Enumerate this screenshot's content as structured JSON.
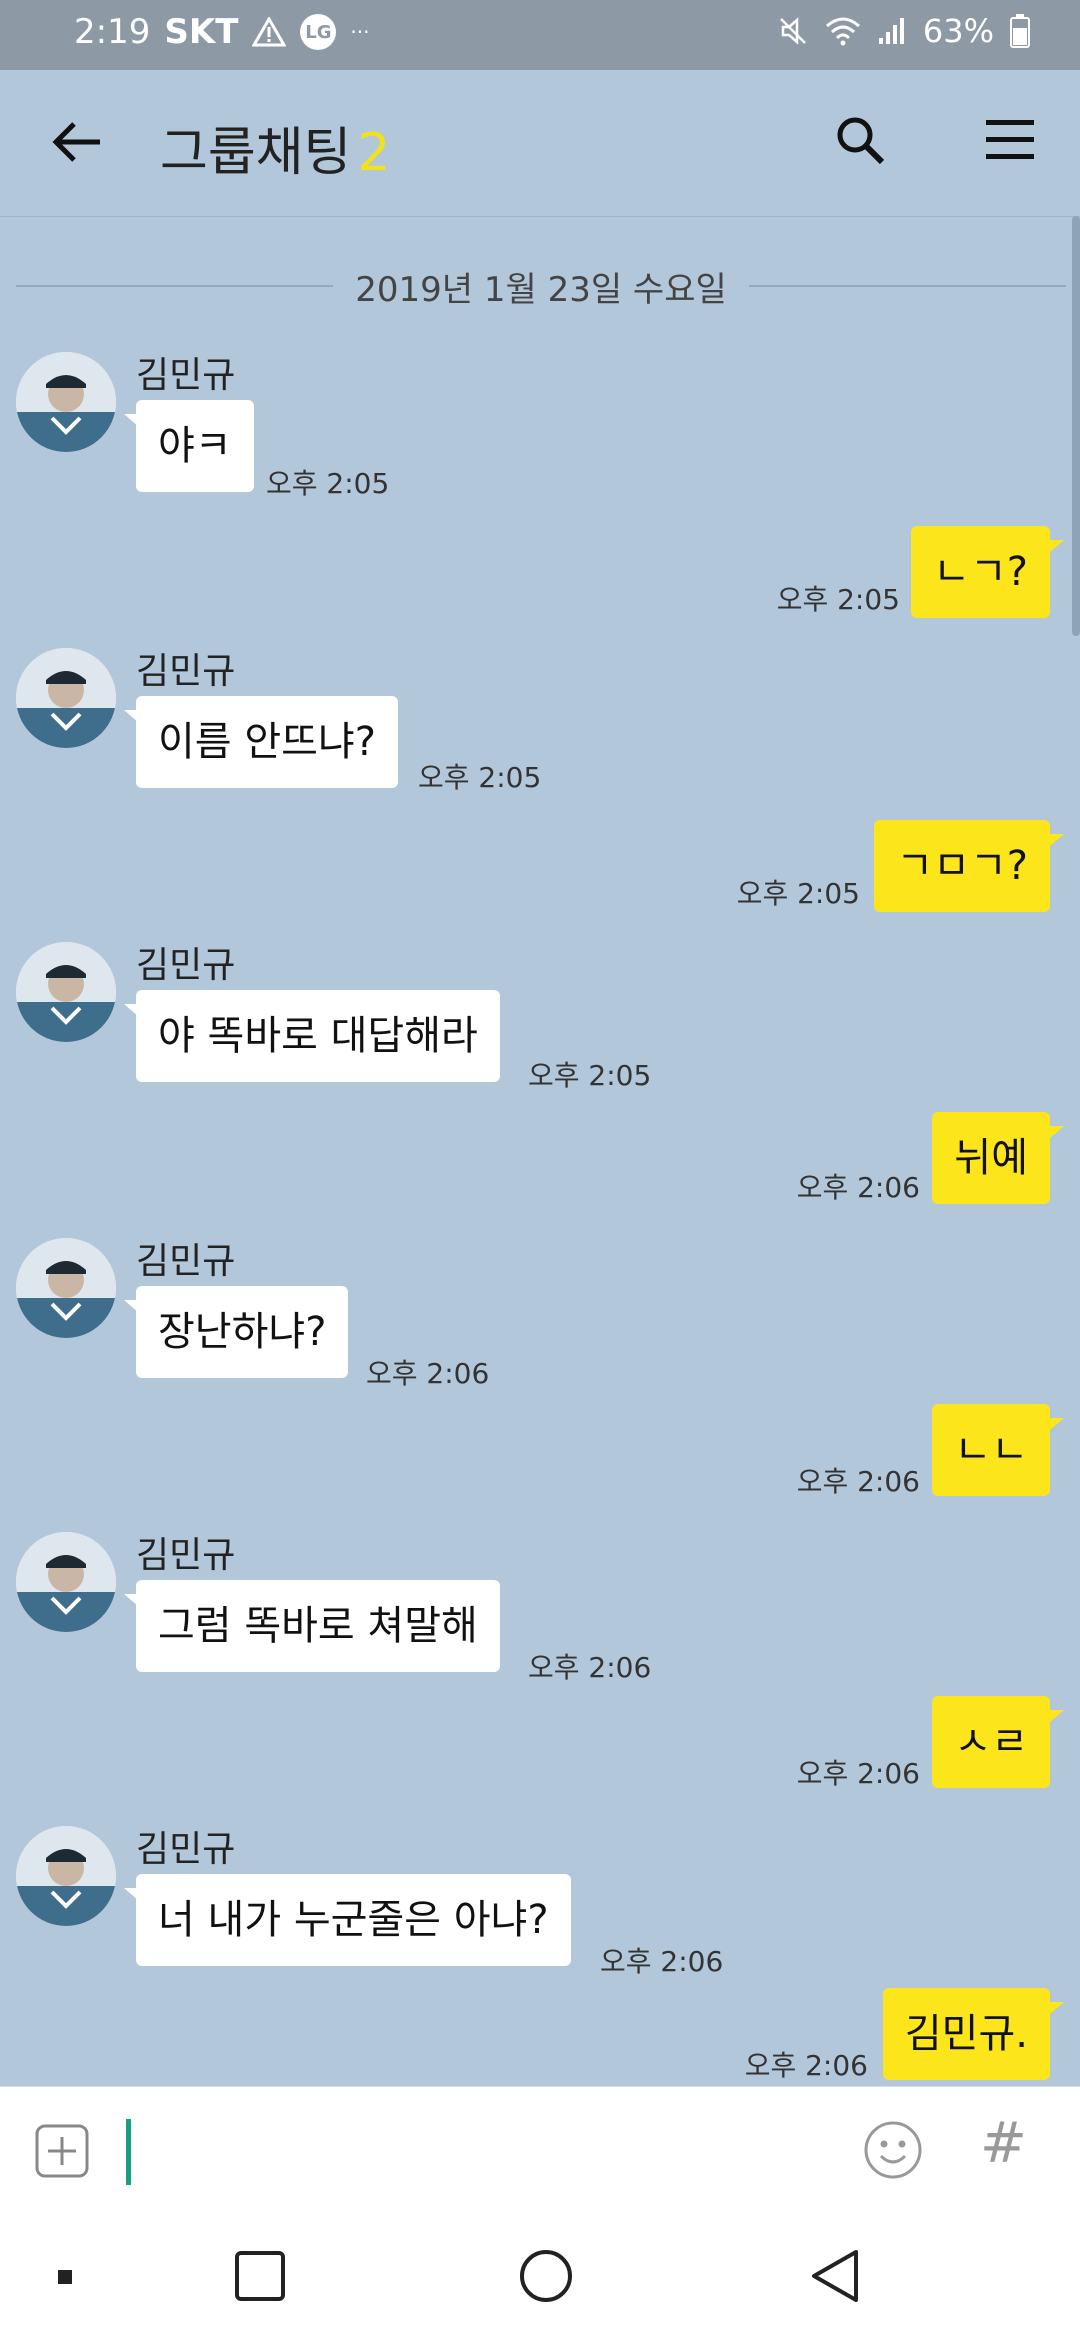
{
  "status_bar": {
    "time": "2:19",
    "carrier": "SKT",
    "lg_badge": "LG",
    "more_dots": "···",
    "battery_percent": "63%"
  },
  "header": {
    "title": "그룹채팅",
    "member_count": "2"
  },
  "chat": {
    "date": "2019년 1월 23일 수요일",
    "sender_name": "김민규",
    "messages": [
      {
        "dir": "in",
        "text": "야ㅋ",
        "time": "오후 2:05"
      },
      {
        "dir": "out",
        "text": "ㄴㄱ?",
        "time": "오후 2:05"
      },
      {
        "dir": "in",
        "text": "이름 안뜨냐?",
        "time": "오후 2:05"
      },
      {
        "dir": "out",
        "text": "ㄱㅁㄱ?",
        "time": "오후 2:05"
      },
      {
        "dir": "in",
        "text": "야 똑바로 대답해라",
        "time": "오후 2:05"
      },
      {
        "dir": "out",
        "text": "뉘예",
        "time": "오후 2:06"
      },
      {
        "dir": "in",
        "text": "장난하냐?",
        "time": "오후 2:06"
      },
      {
        "dir": "out",
        "text": "ㄴㄴ",
        "time": "오후 2:06"
      },
      {
        "dir": "in",
        "text": "그럼 똑바로 쳐말해",
        "time": "오후 2:06"
      },
      {
        "dir": "out",
        "text": "ㅅㄹ",
        "time": "오후 2:06"
      },
      {
        "dir": "in",
        "text": "너 내가 누군줄은 아냐?",
        "time": "오후 2:06"
      },
      {
        "dir": "out",
        "text": "김민규.",
        "time": "오후 2:06"
      }
    ]
  },
  "input": {
    "hash_label": "#"
  },
  "colors": {
    "chat_bg": "#b3c7db",
    "out_bubble": "#fce51b",
    "in_bubble": "#ffffff",
    "accent_count": "#f3e21a",
    "cursor": "#1b9d80"
  }
}
